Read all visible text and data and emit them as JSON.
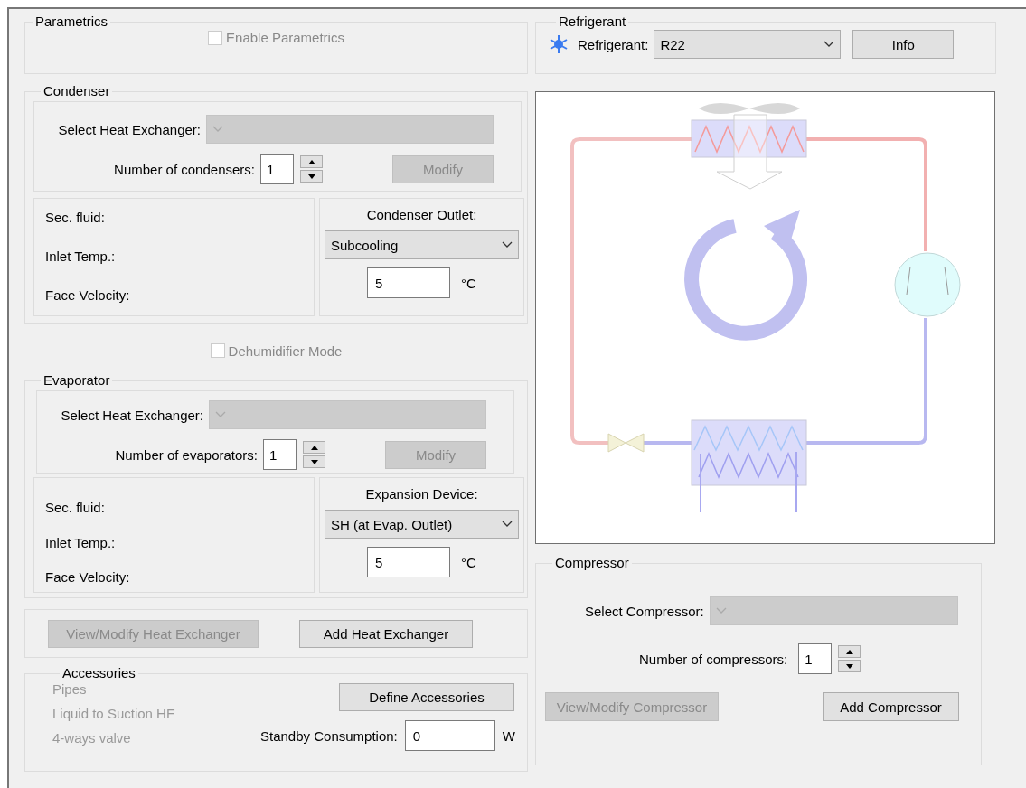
{
  "parametrics": {
    "title": "Parametrics",
    "enable": {
      "label": "Enable Parametrics",
      "checked": false,
      "disabled": true
    }
  },
  "condenser": {
    "title": "Condenser",
    "select": {
      "label": "Select Heat Exchanger:",
      "disabled": true
    },
    "count": {
      "label": "Number of condensers:",
      "value": "1"
    },
    "modify": {
      "label": "Modify",
      "disabled": true
    },
    "info": [
      "Sec. fluid:",
      "Inlet Temp.:",
      "Face Velocity:"
    ],
    "setting": {
      "title": "Condenser Outlet:",
      "value": "Subcooling",
      "input": "5",
      "unit": "°C"
    }
  },
  "dehumidifier": {
    "label": "Dehumidifier Mode",
    "checked": false,
    "disabled": true
  },
  "evaporator": {
    "title": "Evaporator",
    "select": {
      "label": "Select Heat Exchanger:",
      "disabled": true
    },
    "count": {
      "label": "Number of evaporators:",
      "value": "1"
    },
    "modify": {
      "label": "Modify",
      "disabled": true
    },
    "info": [
      "Sec. fluid:",
      "Inlet Temp.:",
      "Face Velocity:"
    ],
    "setting": {
      "title": "Expansion Device:",
      "value": "SH (at Evap. Outlet)",
      "input": "5",
      "unit": "°C"
    }
  },
  "heat_exchanger_buttons": [
    {
      "label": "View/Modify Heat Exchanger",
      "disabled": true
    },
    {
      "label": "Add Heat Exchanger",
      "disabled": false
    }
  ],
  "accessories": {
    "title": "Accessories",
    "items": [
      {
        "label": "Pipes",
        "disabled": true
      },
      {
        "label": "Liquid to Suction HE",
        "disabled": true
      },
      {
        "label": "4-ways valve",
        "disabled": true
      }
    ],
    "define": {
      "label": "Define Accessories",
      "disabled": false
    },
    "standby": {
      "label": "Standby Consumption:",
      "value": "0",
      "unit": "W"
    }
  },
  "refrigerant": {
    "title": "Refrigerant",
    "label": "Refrigerant:",
    "value": "R22",
    "info": {
      "label": "Info",
      "disabled": false
    }
  },
  "compressor": {
    "title": "Compressor",
    "select": {
      "label": "Select Compressor:",
      "disabled": true
    },
    "count": {
      "label": "Number of compressors:",
      "value": "1"
    },
    "buttons": [
      {
        "label": "View/Modify Compressor",
        "disabled": true
      },
      {
        "label": "Add Compressor",
        "disabled": false
      }
    ]
  }
}
